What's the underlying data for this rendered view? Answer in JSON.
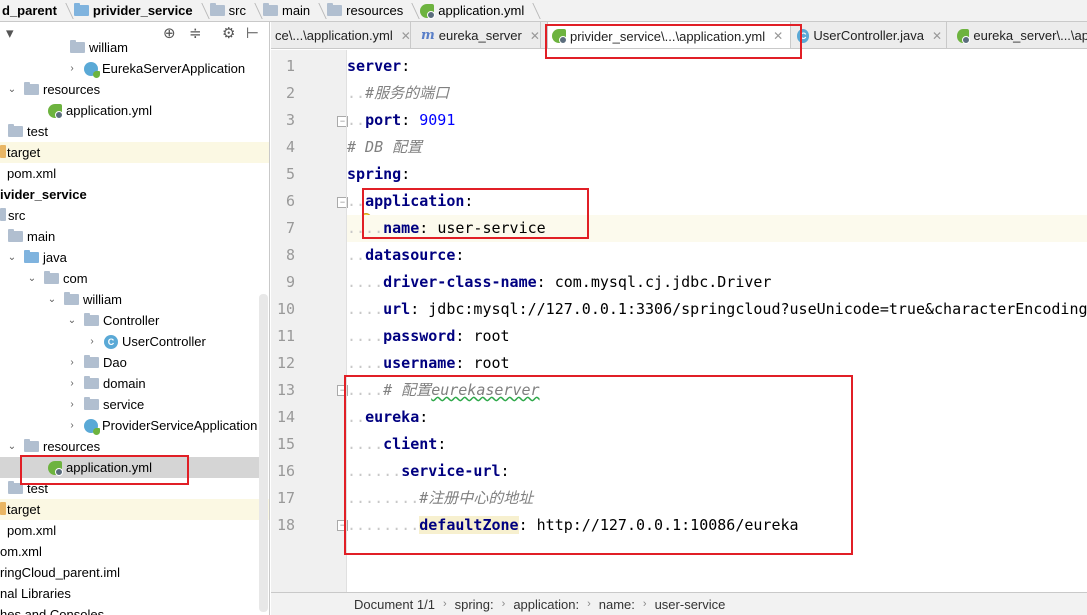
{
  "breadcrumb": [
    {
      "label": "d_parent",
      "bold": true,
      "icon": "module-folder-icon"
    },
    {
      "label": "privider_service",
      "bold": true,
      "icon": "module-folder-icon"
    },
    {
      "label": "src",
      "bold": false,
      "icon": "folder-icon"
    },
    {
      "label": "main",
      "bold": false,
      "icon": "folder-icon"
    },
    {
      "label": "resources",
      "bold": false,
      "icon": "resources-folder-icon"
    },
    {
      "label": "application.yml",
      "bold": false,
      "icon": "spring-yml-icon"
    }
  ],
  "tabs": [
    {
      "label": "ce\\...\\application.yml",
      "active": false
    },
    {
      "label": "eureka_server",
      "active": false
    },
    {
      "label": "privider_service\\...\\application.yml",
      "active": true
    },
    {
      "label": "UserController.java",
      "active": false
    },
    {
      "label": "eureka_server\\...\\ap",
      "active": false
    }
  ],
  "tree": [
    {
      "label": "william",
      "indent": 3
    },
    {
      "label": "EurekaServerApplication",
      "indent": 4
    },
    {
      "label": "resources",
      "indent": 2
    },
    {
      "label": "application.yml",
      "indent": 3
    },
    {
      "label": "test",
      "indent": 1
    },
    {
      "label": "target",
      "indent": 0
    },
    {
      "label": "pom.xml",
      "indent": 0
    },
    {
      "label": "ivider_service",
      "indent": 0
    },
    {
      "label": "src",
      "indent": 0
    },
    {
      "label": "main",
      "indent": 1
    },
    {
      "label": "java",
      "indent": 2
    },
    {
      "label": "com",
      "indent": 3
    },
    {
      "label": "william",
      "indent": 4
    },
    {
      "label": "Controller",
      "indent": 5
    },
    {
      "label": "UserController",
      "indent": 6
    },
    {
      "label": "Dao",
      "indent": 5
    },
    {
      "label": "domain",
      "indent": 5
    },
    {
      "label": "service",
      "indent": 5
    },
    {
      "label": "ProviderServiceApplication",
      "indent": 5
    },
    {
      "label": "resources",
      "indent": 2
    },
    {
      "label": "application.yml",
      "indent": 3
    },
    {
      "label": "test",
      "indent": 1
    },
    {
      "label": "target",
      "indent": 0
    },
    {
      "label": "pom.xml",
      "indent": 0
    },
    {
      "label": "om.xml",
      "indent": 0
    },
    {
      "label": "ringCloud_parent.iml",
      "indent": 0
    },
    {
      "label": "nal Libraries",
      "indent": 0
    },
    {
      "label": "hes and Consoles",
      "indent": 0
    }
  ],
  "code": {
    "line_numbers": [
      "1",
      "2",
      "3",
      "4",
      "5",
      "6",
      "7",
      "8",
      "9",
      "10",
      "11",
      "12",
      "13",
      "14",
      "15",
      "16",
      "17",
      "18"
    ],
    "l1_key": "server",
    "l2_comment": "#服务的端口",
    "l3_key": "port",
    "l3_val": "9091",
    "l4_comment": "# DB 配置",
    "l5_key": "spring",
    "l6_key": "application",
    "l7_key": "name",
    "l7_val": "user-service",
    "l8_key": "datasource",
    "l9_key": "driver-class-name",
    "l9_val": "com.mysql.cj.jdbc.Driver",
    "l10_key": "url",
    "l10_val": "jdbc:mysql://127.0.0.1:3306/springcloud?useUnicode=true&characterEncoding",
    "l11_key": "password",
    "l11_val": "root",
    "l12_key": "username",
    "l12_val": "root",
    "l13_comment_prefix": "# 配置",
    "l13_comment_word": "eurekaserver",
    "l14_key": "eureka",
    "l15_key": "client",
    "l16_key": "service-url",
    "l17_comment": "#注册中心的地址",
    "l18_key": "defaultZone",
    "l18_val": "http://127.0.0.1:10086/eureka"
  },
  "status": {
    "document": "Document 1/1",
    "path": [
      "spring:",
      "application:",
      "name:",
      "user-service"
    ]
  },
  "colors": {
    "annotation_red": "#e11f26",
    "key_navy": "#000080",
    "number_blue": "#0000ff",
    "comment_gray": "#808080"
  }
}
